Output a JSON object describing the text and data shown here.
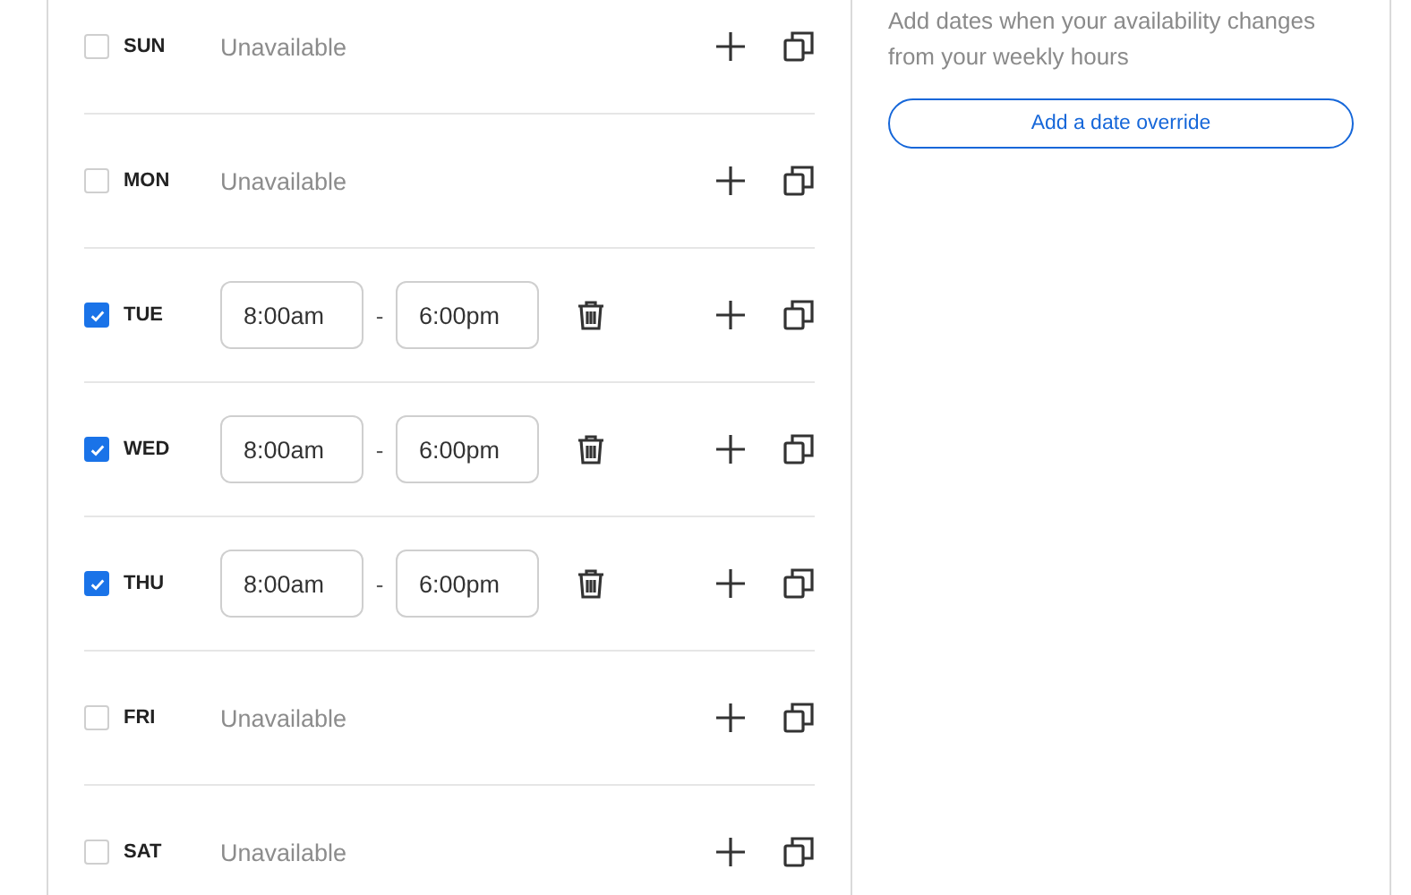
{
  "weekly_hours": {
    "days": [
      {
        "label": "SUN",
        "checked": false,
        "status": "Unavailable"
      },
      {
        "label": "MON",
        "checked": false,
        "status": "Unavailable"
      },
      {
        "label": "TUE",
        "checked": true,
        "start": "8:00am",
        "separator": "-",
        "end": "6:00pm"
      },
      {
        "label": "WED",
        "checked": true,
        "start": "8:00am",
        "separator": "-",
        "end": "6:00pm"
      },
      {
        "label": "THU",
        "checked": true,
        "start": "8:00am",
        "separator": "-",
        "end": "6:00pm"
      },
      {
        "label": "FRI",
        "checked": false,
        "status": "Unavailable"
      },
      {
        "label": "SAT",
        "checked": false,
        "status": "Unavailable"
      }
    ]
  },
  "date_overrides": {
    "description": "Add dates when your availability changes from your weekly hours",
    "button": "Add a date override"
  }
}
